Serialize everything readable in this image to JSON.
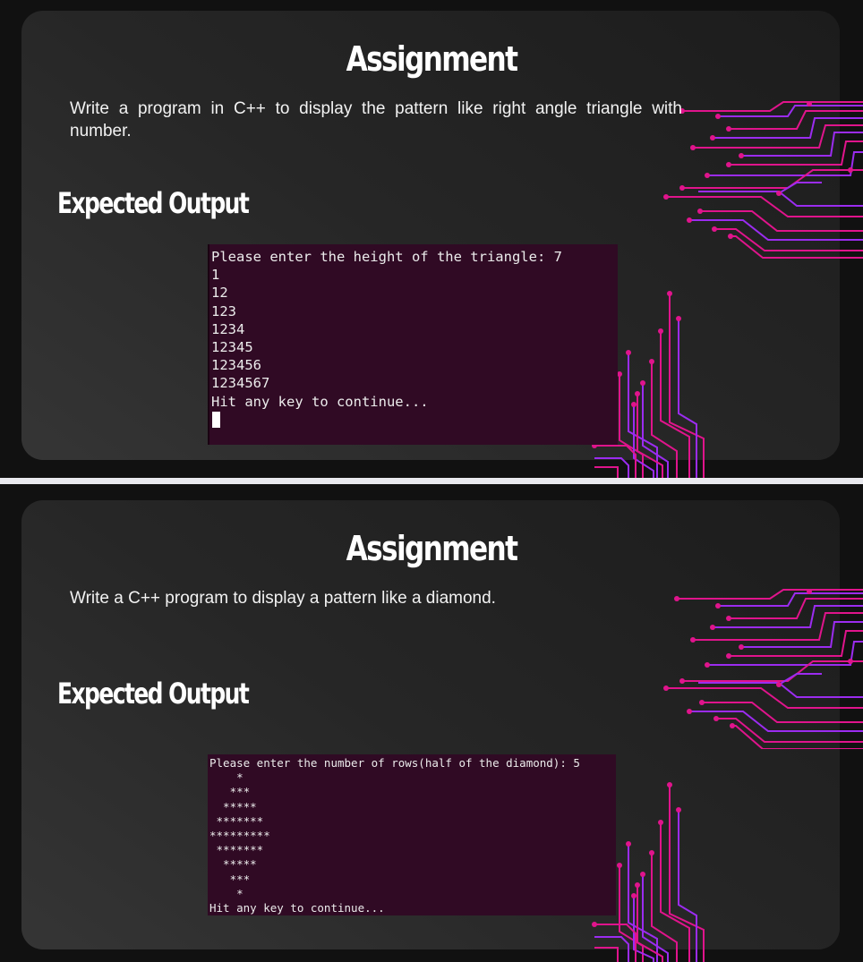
{
  "slides": [
    {
      "title": "Assignment",
      "description": "Write a program in C++ to display the pattern like right angle triangle with number.",
      "expected_heading": "Expected Output",
      "terminal_lines": [
        "Please enter the height of the triangle: 7",
        "1",
        "12",
        "123",
        "1234",
        "12345",
        "123456",
        "1234567",
        "Hit any key to continue..."
      ]
    },
    {
      "title": "Assignment",
      "description": "Write a C++ program to display a pattern like a diamond.",
      "expected_heading": "Expected Output",
      "terminal_lines": [
        "Please enter the number of rows(half of the diamond): 5",
        "    *",
        "   ***",
        "  *****",
        " *******",
        "*********",
        " *******",
        "  *****",
        "   ***",
        "    *",
        "Hit any key to continue..."
      ]
    }
  ],
  "colors": {
    "terminal_bg": "#300a24",
    "circuit_pink": "#e0148c",
    "circuit_purple": "#9b2cf0"
  },
  "icons": [
    "circuit-decoration"
  ]
}
